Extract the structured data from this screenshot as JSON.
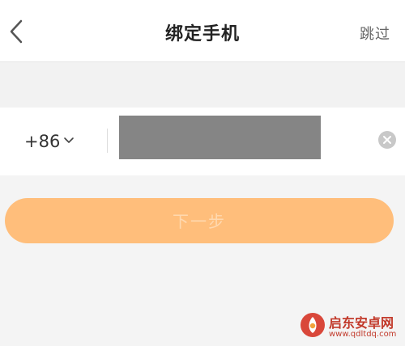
{
  "header": {
    "title": "绑定手机",
    "skip_label": "跳过"
  },
  "phone": {
    "country_code": "+86",
    "number_value": ""
  },
  "actions": {
    "next_label": "下一步"
  },
  "watermark": {
    "title": "启东安卓网",
    "url": "www.qdltdq.com"
  },
  "colors": {
    "button": "#ffbe7b",
    "button_text": "#ffd9b0",
    "redacted": "#858585",
    "watermark": "#c23a2b"
  },
  "icons": {
    "back": "back-arrow-icon",
    "country_dropdown": "chevron-down-icon",
    "clear": "clear-icon"
  }
}
